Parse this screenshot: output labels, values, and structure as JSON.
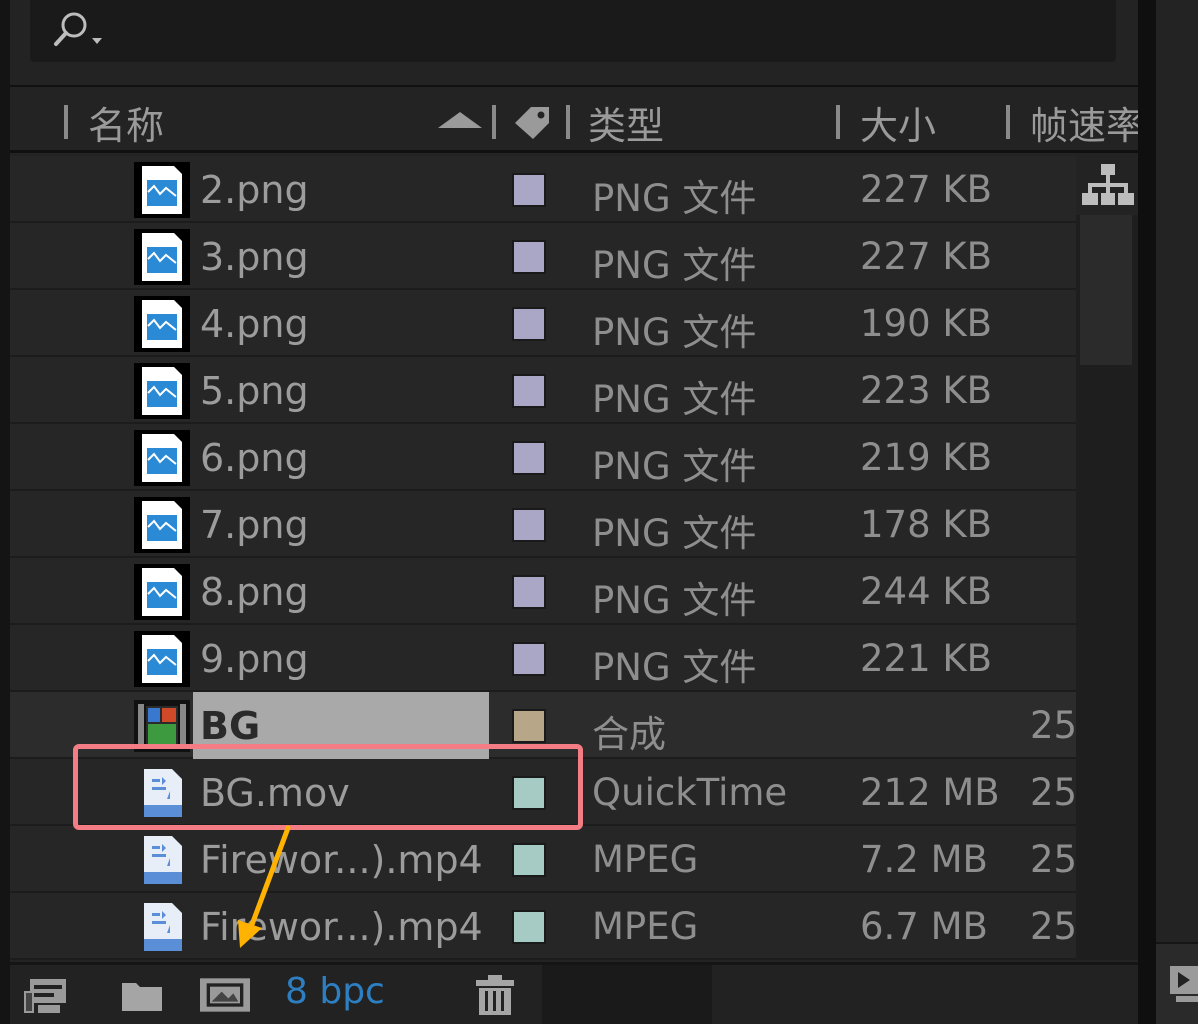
{
  "search": {
    "placeholder": ""
  },
  "columns": {
    "name": "名称",
    "type": "类型",
    "size": "大小",
    "fps": "帧速率"
  },
  "rows": [
    {
      "name": "2.png",
      "type": "PNG 文件",
      "size": "227 KB",
      "fps": "",
      "label_color": "#a9a6c6",
      "icon": "png-file-icon"
    },
    {
      "name": "3.png",
      "type": "PNG 文件",
      "size": "227 KB",
      "fps": "",
      "label_color": "#a9a6c6",
      "icon": "png-file-icon"
    },
    {
      "name": "4.png",
      "type": "PNG 文件",
      "size": "190 KB",
      "fps": "",
      "label_color": "#a9a6c6",
      "icon": "png-file-icon"
    },
    {
      "name": "5.png",
      "type": "PNG 文件",
      "size": "223 KB",
      "fps": "",
      "label_color": "#a9a6c6",
      "icon": "png-file-icon"
    },
    {
      "name": "6.png",
      "type": "PNG 文件",
      "size": "219 KB",
      "fps": "",
      "label_color": "#a9a6c6",
      "icon": "png-file-icon"
    },
    {
      "name": "7.png",
      "type": "PNG 文件",
      "size": "178 KB",
      "fps": "",
      "label_color": "#a9a6c6",
      "icon": "png-file-icon"
    },
    {
      "name": "8.png",
      "type": "PNG 文件",
      "size": "244 KB",
      "fps": "",
      "label_color": "#a9a6c6",
      "icon": "png-file-icon"
    },
    {
      "name": "9.png",
      "type": "PNG 文件",
      "size": "221 KB",
      "fps": "",
      "label_color": "#a9a6c6",
      "icon": "png-file-icon"
    },
    {
      "name": "BG",
      "type": "合成",
      "size": "",
      "fps": "25",
      "label_color": "#b8a689",
      "icon": "composition-icon"
    },
    {
      "name": "BG.mov",
      "type": "QuickTime",
      "size": "212 MB",
      "fps": "25",
      "label_color": "#a6cbc4",
      "icon": "video-file-icon"
    },
    {
      "name": "Firewor...).mp4",
      "type": "MPEG",
      "size": "7.2 MB",
      "fps": "25",
      "label_color": "#a6cbc4",
      "icon": "video-file-icon"
    },
    {
      "name": "Firewor...).mp4",
      "type": "MPEG",
      "size": "6.7 MB",
      "fps": "25",
      "label_color": "#a6cbc4",
      "icon": "video-file-icon"
    }
  ],
  "bottom_bar": {
    "bpc": "8 bpc",
    "icons": [
      "interpret-footage-icon",
      "new-folder-icon",
      "new-composition-icon",
      "trash-icon"
    ]
  },
  "colors": {
    "accent_blue": "#2d7fc1",
    "highlight_box": "#f47c84",
    "arrow": "#ffb300"
  }
}
